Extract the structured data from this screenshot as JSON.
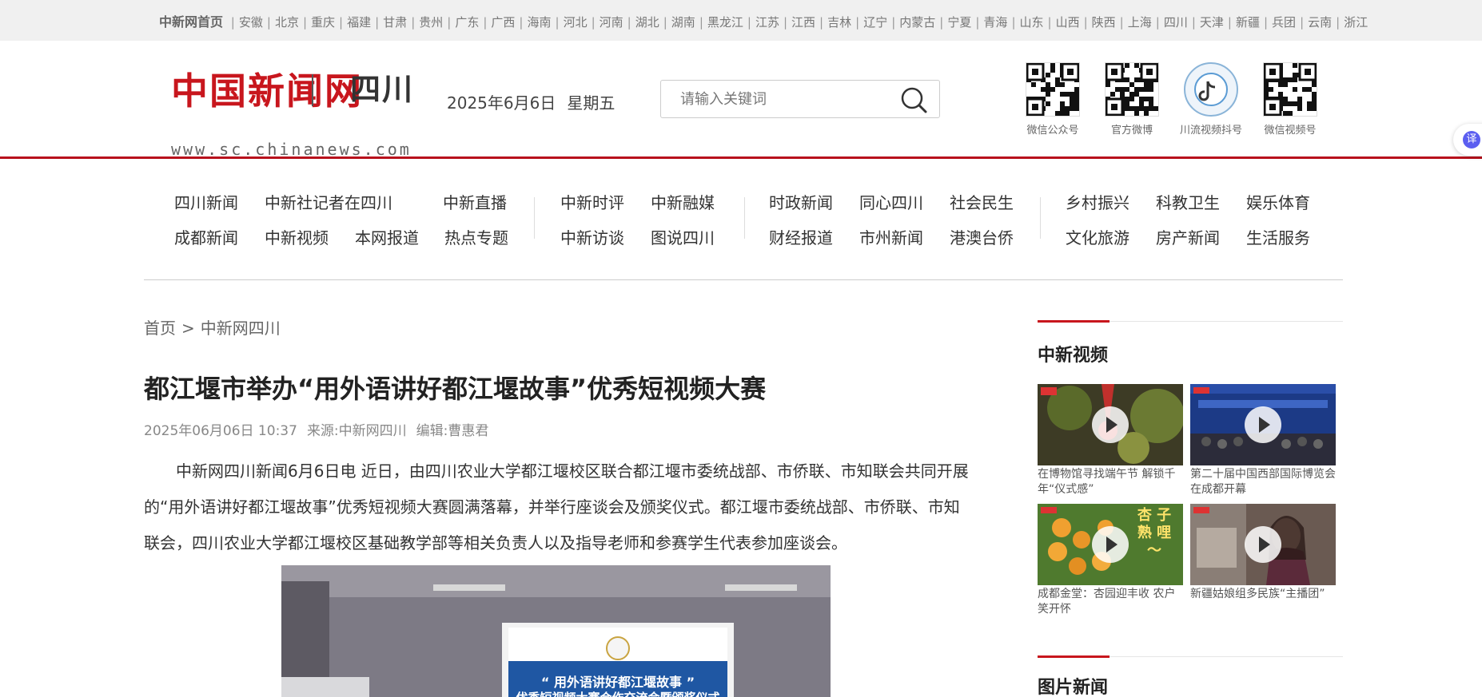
{
  "topbar": {
    "home": "中新网首页",
    "provinces": [
      "安徽",
      "北京",
      "重庆",
      "福建",
      "甘肃",
      "贵州",
      "广东",
      "广西",
      "海南",
      "河北",
      "河南",
      "湖北",
      "湖南",
      "黑龙江",
      "江苏",
      "江西",
      "吉林",
      "辽宁",
      "内蒙古",
      "宁夏",
      "青海",
      "山东",
      "山西",
      "陕西",
      "上海",
      "四川",
      "天津",
      "新疆",
      "兵团",
      "云南",
      "浙江"
    ]
  },
  "header": {
    "logo_cn": "中国新闻网",
    "logo_sc": "四川",
    "logo_url": "www.sc.chinanews.com",
    "date": "2025年6月6日",
    "weekday": "星期五",
    "search_placeholder": "请输入关键词",
    "qr": [
      {
        "label": "微信公众号"
      },
      {
        "label": "官方微博"
      },
      {
        "label": "川流视频抖号"
      },
      {
        "label": "微信视频号"
      }
    ],
    "translate": "译"
  },
  "nav": {
    "groups": [
      {
        "items": [
          [
            "四川新闻",
            "中新社记者在四川",
            "中新直播"
          ],
          [
            "成都新闻",
            "中新视频",
            "本网报道",
            "热点专题"
          ]
        ]
      },
      {
        "items": [
          [
            "中新时评",
            "中新融媒"
          ],
          [
            "中新访谈",
            "图说四川"
          ]
        ]
      },
      {
        "items": [
          [
            "时政新闻",
            "同心四川",
            "社会民生"
          ],
          [
            "财经报道",
            "市州新闻",
            "港澳台侨"
          ]
        ]
      },
      {
        "items": [
          [
            "乡村振兴",
            "科教卫生",
            "娱乐体育"
          ],
          [
            "文化旅游",
            "房产新闻",
            "生活服务"
          ]
        ]
      }
    ]
  },
  "breadcrumb": {
    "home": "首页",
    "arrow": ">",
    "section": "中新网四川"
  },
  "article": {
    "title": "都江堰市举办“用外语讲好都江堰故事”优秀短视频大赛",
    "time": "2025年06月06日 10:37",
    "source": "来源:中新网四川",
    "editor": "编辑:曹惠君",
    "paragraph": "中新网四川新闻6月6日电 近日，由四川农业大学都江堰校区联合都江堰市委统战部、市侨联、市知联会共同开展的“用外语讲好都江堰故事”优秀短视频大赛圆满落幕，并举行座谈会及颁奖仪式。都江堰市委统战部、市侨联、市知联会，四川农业大学都江堰校区基础教学部等相关负责人以及指导老师和参赛学生代表参加座谈会。",
    "screen_line1": "“ 用外语讲好都江堰故事 ”",
    "screen_line2": "优秀短视频大赛合作交流会暨颁奖仪式"
  },
  "sidebar": {
    "video_title": "中新视频",
    "videos": [
      {
        "caption": "在博物馆寻找端午节 解锁千年“仪式感”",
        "badge": "视频"
      },
      {
        "caption": "第二十届中国西部国际博览会在成都开幕",
        "badge": "视频"
      },
      {
        "caption": "成都金堂：杏园迎丰收 农户笑开怀",
        "badge": "视频",
        "overlay": "杏 子 熟 哩 ～"
      },
      {
        "caption": "新疆姑娘组多民族“主播团”",
        "badge": "视频"
      }
    ],
    "photo_title": "图片新闻"
  },
  "colors": {
    "brand_red": "#c8161d",
    "nav_line": "#b8111c"
  }
}
